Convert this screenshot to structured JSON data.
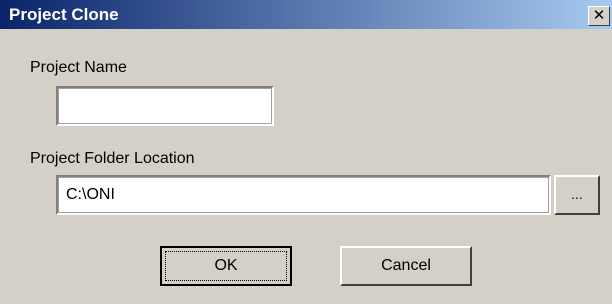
{
  "window": {
    "title": "Project Clone",
    "close_glyph": "✕"
  },
  "form": {
    "project_name_label": "Project Name",
    "project_name_value": "",
    "folder_location_label": "Project Folder Location",
    "folder_location_value": "C:\\ONI",
    "browse_label": "..."
  },
  "buttons": {
    "ok_label": "OK",
    "cancel_label": "Cancel"
  },
  "colors": {
    "titlebar_start": "#0a246a",
    "titlebar_end": "#a6caf0",
    "face": "#d4d0c8"
  }
}
